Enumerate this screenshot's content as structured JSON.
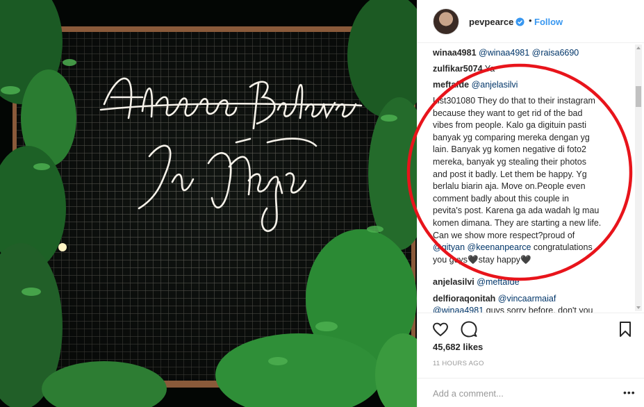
{
  "photo": {
    "neon_text": [
      "Always Believe",
      "In Magic"
    ]
  },
  "post_header": {
    "username": "pevpearce",
    "separator": "•",
    "follow_label": "Follow",
    "verified_icon": "verified-badge-icon",
    "accent_color": "#3897f0"
  },
  "comments": [
    {
      "user": "winaa4981",
      "parts": [
        "@winaa4981 @raisa6690"
      ]
    },
    {
      "user": "zulfikar5074",
      "text": "Ya"
    },
    {
      "user": "meftafde",
      "mention": "@anjelasilvi"
    },
    {
      "user": "List301080",
      "lines": [
        "They do that to their instagram",
        "because they want to get rid of the bad",
        "vibes from people. Kalo ga digituin pasti",
        "banyak yg comparing mereka dengan yg",
        "lain. Banyak yg komen negative di foto2",
        "mereka, banyak yg stealing their photos",
        "and post it badly. Let them be happy. Yg",
        "berlalu biarin aja. Move on.People even",
        "comment badly about this couple in",
        "pevita's post. Karena ga ada wadah lg mau",
        "komen dimana. They are starting a new life.",
        "Can we show more respect?proud of"
      ],
      "mentions_line": "@gityan @keenanpearce",
      "mentions_tail": " congratulations",
      "closing": "you guys🖤stay happy🖤"
    },
    {
      "user": "anjelasilvi",
      "mention": "@meftafde"
    },
    {
      "user": "delfioraqonitah",
      "mention": "@vincaarmaiaf",
      "second_line_mention": "@winaa4981",
      "second_line_text": " guys sorry before, don't you"
    }
  ],
  "actions": {
    "like_icon": "heart-icon",
    "comment_icon": "comment-bubble-icon",
    "save_icon": "bookmark-icon"
  },
  "likes": "45,682 likes",
  "timestamp": "11 HOURS AGO",
  "add_comment": {
    "placeholder": "Add a comment...",
    "more_label": "•••"
  },
  "annotation_color": "#e8141b"
}
